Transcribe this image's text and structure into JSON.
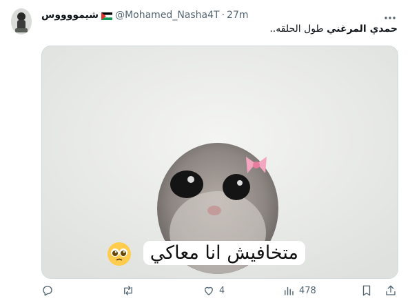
{
  "tweet": {
    "display_name": "شيمووووس",
    "handle": "@Mohamed_Nasha4T",
    "separator": "·",
    "time": "27m",
    "text_bold": "حمدي المرغني",
    "text_rest": " طول الحلقه.."
  },
  "media": {
    "caption": "متخافيش انا معاكي"
  },
  "actions": {
    "replies": "",
    "retweets": "",
    "likes": "4",
    "views": "478"
  },
  "icons": {
    "more": "more-icon",
    "reply": "reply-icon",
    "retweet": "retweet-icon",
    "like": "heart-icon",
    "views": "views-icon",
    "bookmark": "bookmark-icon",
    "share": "share-icon"
  },
  "colors": {
    "text": "#0f1419",
    "muted": "#536471",
    "border": "#cfd9de"
  }
}
